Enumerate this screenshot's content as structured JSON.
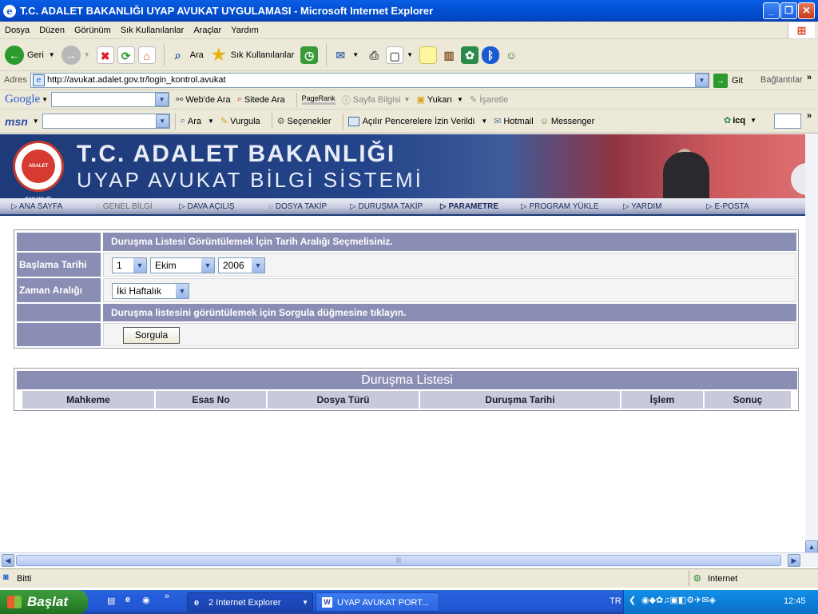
{
  "window": {
    "title": "T.C. ADALET BAKANLIĞI UYAP AVUKAT UYGULAMASI - Microsoft Internet Explorer"
  },
  "menubar": {
    "items": [
      "Dosya",
      "Düzen",
      "Görünüm",
      "Sık Kullanılanlar",
      "Araçlar",
      "Yardım"
    ]
  },
  "toolbar": {
    "back": "Geri",
    "search": "Ara",
    "favorites": "Sık Kullanılanlar"
  },
  "addressbar": {
    "label": "Adres",
    "url": "http://avukat.adalet.gov.tr/login_kontrol.avukat",
    "go": "Git",
    "links": "Bağlantılar"
  },
  "googlebar": {
    "logo": "Google",
    "web_search": "Web'de Ara",
    "site_search": "Sitede Ara",
    "pagerank": "PageRank",
    "page_info": "Sayfa Bilgisi",
    "up": "Yukarı",
    "highlight": "İşaretle"
  },
  "msnbar": {
    "logo": "msn",
    "search": "Ara",
    "highlight": "Vurgula",
    "options": "Seçenekler",
    "popups": "Açılır Pencerelere İzin Verildi",
    "hotmail": "Hotmail",
    "messenger": "Messenger",
    "icq": "icq"
  },
  "banner": {
    "line1": "T.C. ADALET BAKANLIĞI",
    "line2": "UYAP AVUKAT BİLGİ SİSTEMİ",
    "seal_text": "ADALET BAKANLIĞI"
  },
  "nav": {
    "items": [
      "ANA SAYFA",
      "GENEL BİLGİ",
      "DAVA AÇILIŞ",
      "DOSYA TAKİP",
      "DURUŞMA TAKİP",
      "PARAMETRE",
      "PROGRAM YÜKLE",
      "YARDIM",
      "E-POSTA"
    ]
  },
  "form": {
    "header": "Duruşma Listesi Görüntülemek İçin Tarih Aralığı Seçmelisiniz.",
    "start_label": "Başlama Tarihi",
    "day": "1",
    "month": "Ekim",
    "year": "2006",
    "range_label": "Zaman Aralığı",
    "range": "İki Haftalık",
    "info": "Duruşma listesini görüntülemek için Sorgula düğmesine tıklayın.",
    "submit": "Sorgula"
  },
  "list": {
    "title": "Duruşma Listesi",
    "columns": [
      "Mahkeme",
      "Esas No",
      "Dosya Türü",
      "Duruşma Tarihi",
      "İşlem",
      "Sonuç"
    ]
  },
  "status": {
    "text": "Bitti",
    "zone": "Internet"
  },
  "taskbar": {
    "start": "Başlat",
    "task1": "2 Internet Explorer",
    "task2": "UYAP AVUKAT PORT...",
    "lang": "TR",
    "clock": "12:45"
  },
  "colors": {
    "accent": "#8b8eb4",
    "banner_blue": "#1e3a78",
    "xp_blue": "#245edb"
  }
}
